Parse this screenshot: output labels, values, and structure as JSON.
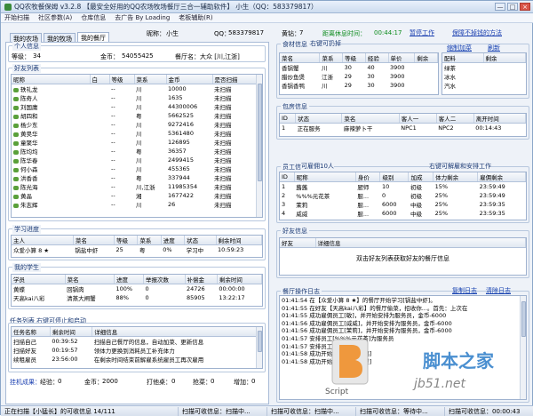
{
  "window": {
    "title": "QQ农牧餐保姆 v3.2.8 【最安全好用的QQ农场牧场餐厅三合一辅助软件】 小生（QQ：583379817）",
    "min": "—",
    "max": "□",
    "close": "×"
  },
  "menu": [
    "开始扫描",
    "社区参数(A)",
    "仓库信息",
    "去广告 By Loading",
    "老板辅助(R)"
  ],
  "tabs": [
    "我的农场",
    "我的牧场",
    "我的餐厅"
  ],
  "top": {
    "nick_label": "昵称：",
    "nick_value": "小生",
    "qq_label": "QQ：",
    "qq_value": "583379817",
    "level_label": "黄钻：",
    "level_value": "7",
    "countdown_label": "距离休息时间：",
    "countdown_value": "00:44:17",
    "pause_btn": "暂停工作",
    "guard_btn": "保障不掉钱的方法"
  },
  "personal": {
    "title": "个人信息",
    "level_label": "等级：",
    "level_value": "34",
    "gold_label": "金币：",
    "gold_value": "54055425",
    "hall_label": "餐厅名：",
    "hall_value": "大众 [川,江浙]"
  },
  "friends": {
    "title": "好友列表",
    "columns": [
      "昵称",
      "白",
      "等级",
      "菜系",
      "金币",
      "是否扫描"
    ],
    "rows": [
      [
        "轶礼龙",
        "",
        "--",
        "川",
        "10000",
        "未扫描"
      ],
      [
        "陈奇人",
        "",
        "--",
        "川",
        "1635",
        "未扫描"
      ],
      [
        "刘国庸",
        "",
        "--",
        "川",
        "44300006",
        "未扫描"
      ],
      [
        "胡四和",
        "",
        "--",
        "粤",
        "5662525",
        "未扫描"
      ],
      [
        "杨少东",
        "",
        "--",
        "川",
        "9272416",
        "未扫描"
      ],
      [
        "黄昊华",
        "",
        "--",
        "川",
        "5361480",
        "未扫描"
      ],
      [
        "童聚华",
        "",
        "--",
        "川",
        "126895",
        "未扫描"
      ],
      [
        "陈均均",
        "",
        "--",
        "粤",
        "36357",
        "未扫描"
      ],
      [
        "陈华春",
        "",
        "--",
        "川",
        "2499415",
        "未扫描"
      ],
      [
        "何小森",
        "",
        "--",
        "川",
        "455365",
        "未扫描"
      ],
      [
        "洪香香",
        "",
        "--",
        "粤",
        "337944",
        "未扫描"
      ],
      [
        "陈光海",
        "",
        "--",
        "川,江浙",
        "11985354",
        "未扫描"
      ],
      [
        "黄晶",
        "",
        "--",
        "湘",
        "1677422",
        "未扫描"
      ],
      [
        "朱志辉",
        "",
        "--",
        "川",
        "26",
        "未扫描"
      ]
    ]
  },
  "study": {
    "title": "学习进度",
    "columns": [
      "主人",
      "菜名",
      "等级",
      "菜系",
      "进度",
      "状态",
      "剩余时间"
    ],
    "rows": [
      [
        "众爱小算 8 ★",
        "锅盐中虾",
        "25",
        "粤",
        "0%",
        "学习中",
        "10:59:23"
      ]
    ]
  },
  "students": {
    "title": "我的学生",
    "columns": [
      "学员",
      "菜名",
      "进度",
      "举报次数",
      "补偿金",
      "剩余时间"
    ],
    "rows": [
      [
        "黄蝶",
        "回锅肉",
        "100%",
        "0",
        "24726",
        "00:00:00"
      ],
      [
        "天高kai八彩",
        "清蒸大闸蟹",
        "88%",
        "0",
        "85905",
        "13:22:17"
      ]
    ]
  },
  "tasks": {
    "title": "任务列表",
    "hint": "右键可停止和启动",
    "columns": [
      "任务名称",
      "剩余时间",
      "详细信息"
    ],
    "rows": [
      [
        "扫描自己",
        "00:39:52",
        "扫描自己餐厅的信息，自动加菜、更新信息"
      ],
      [
        "扫描好友",
        "00:19:57",
        "领体力更换到消耗员工补充体力"
      ],
      [
        "续租雇员",
        "23:56:00",
        "在剩余时间结束前解雇系统雇员工再次雇用"
      ]
    ]
  },
  "stats": {
    "hangup_label": "挂机成果：",
    "exp_label": "经验：",
    "exp_value": "0",
    "gold_label": "金币：",
    "gold_value": "2000",
    "rob_label": "打他桌：",
    "rob_value": "0",
    "steal_label": "抢菜：",
    "steal_value": "0",
    "add_label": "增加：",
    "add_value": "0"
  },
  "food": {
    "title": "食材信息",
    "hint": "右键可扔掉",
    "add_link": "缩制加菜",
    "refresh_link": "刷新",
    "columns": [
      "菜名",
      "菜系",
      "等级",
      "经验",
      "单价",
      "剩余"
    ],
    "rows": [
      [
        "香锅蟹",
        "川",
        "30",
        "40",
        "3900",
        ""
      ],
      [
        "腊炒鱼煲",
        "江浙",
        "29",
        "30",
        "3900",
        ""
      ],
      [
        "香锅香鸭",
        "川",
        "29",
        "30",
        "3900",
        ""
      ]
    ],
    "seasoning_columns": [
      "配料",
      "剩余"
    ],
    "seasoning_rows": [
      [
        "绿茶",
        ""
      ],
      [
        "冰水",
        ""
      ],
      [
        "汽水",
        ""
      ]
    ]
  },
  "rooms": {
    "title": "包房信息",
    "columns": [
      "ID",
      "状态",
      "菜名",
      "客人一",
      "客人二",
      "离开时间"
    ],
    "rows": [
      [
        "1",
        "正在服务",
        "麻辣萝卜干",
        "NPC1",
        "NPC2",
        "00:14:43"
      ]
    ]
  },
  "staff": {
    "title": "员工信息",
    "hint": "可雇佣10人",
    "hint2": "右键可解雇和安排工作",
    "columns": [
      "ID",
      "昵称",
      "身价",
      "级别",
      "加成",
      "体力剩余",
      "雇佣剩余"
    ],
    "rows": [
      [
        "1",
        "蕗蕗",
        "厨师",
        "10",
        "初级",
        "15%",
        "23:59:49"
      ],
      [
        "2",
        "%%%元花茶",
        "服...",
        "0",
        "初级",
        "25%",
        "23:59:49"
      ],
      [
        "3",
        "茉莉",
        "服...",
        "6000",
        "中级",
        "25%",
        "23:59:35"
      ],
      [
        "4",
        "威威",
        "服...",
        "6000",
        "中级",
        "25%",
        "23:59:35"
      ],
      [
        "5",
        "敏",
        "服...",
        "6000",
        "中级",
        "25%",
        "23:59:35"
      ]
    ]
  },
  "friendinfo": {
    "title": "好友信息",
    "columns": [
      "好友",
      "详细信息"
    ],
    "message": "双击好友列表获取好友的餐厅信息"
  },
  "log": {
    "title": "餐厅操作日志",
    "copy_link": "复制日志",
    "clear_link": "清除日志",
    "lines": [
      "01:41:54 在【众爱小算 8 ★】的餐厅开始学习[锅盐中虾]。",
      "01:41:55 在好友【天高kai八彩】的餐厅偷菜，招收你...。首先：上次在",
      "01:41:55 成功雇佣员工[敏]，并开始安排为服务员，金币-6000",
      "01:41:56 成功雇佣员工[威威]，并开始安排为服务员，金币-6000",
      "01:41:56 成功雇佣员工[茉莉]，并开始安排为服务员，金币-6000",
      "01:41:57 安排员工[%%%元花茶]为服务员",
      "01:41:57 安排员工[蕗蕗]为厨师",
      "01:41:58 成功开始做菜[香锅香鸭]",
      "01:41:58 成功开始做菜[腊炒鱼煲]"
    ]
  },
  "statusbar": [
    "正在扫描【小猛长】的可收信息 14/111",
    "扫描可收信息：扫描中...",
    "扫描可收信息：扫描中...",
    "扫描可收信息：等待中...",
    "扫描可收信息：00:00:43"
  ],
  "watermark": {
    "text_cn": "脚本之家",
    "text_en": "jb51.net",
    "script": "Script"
  }
}
